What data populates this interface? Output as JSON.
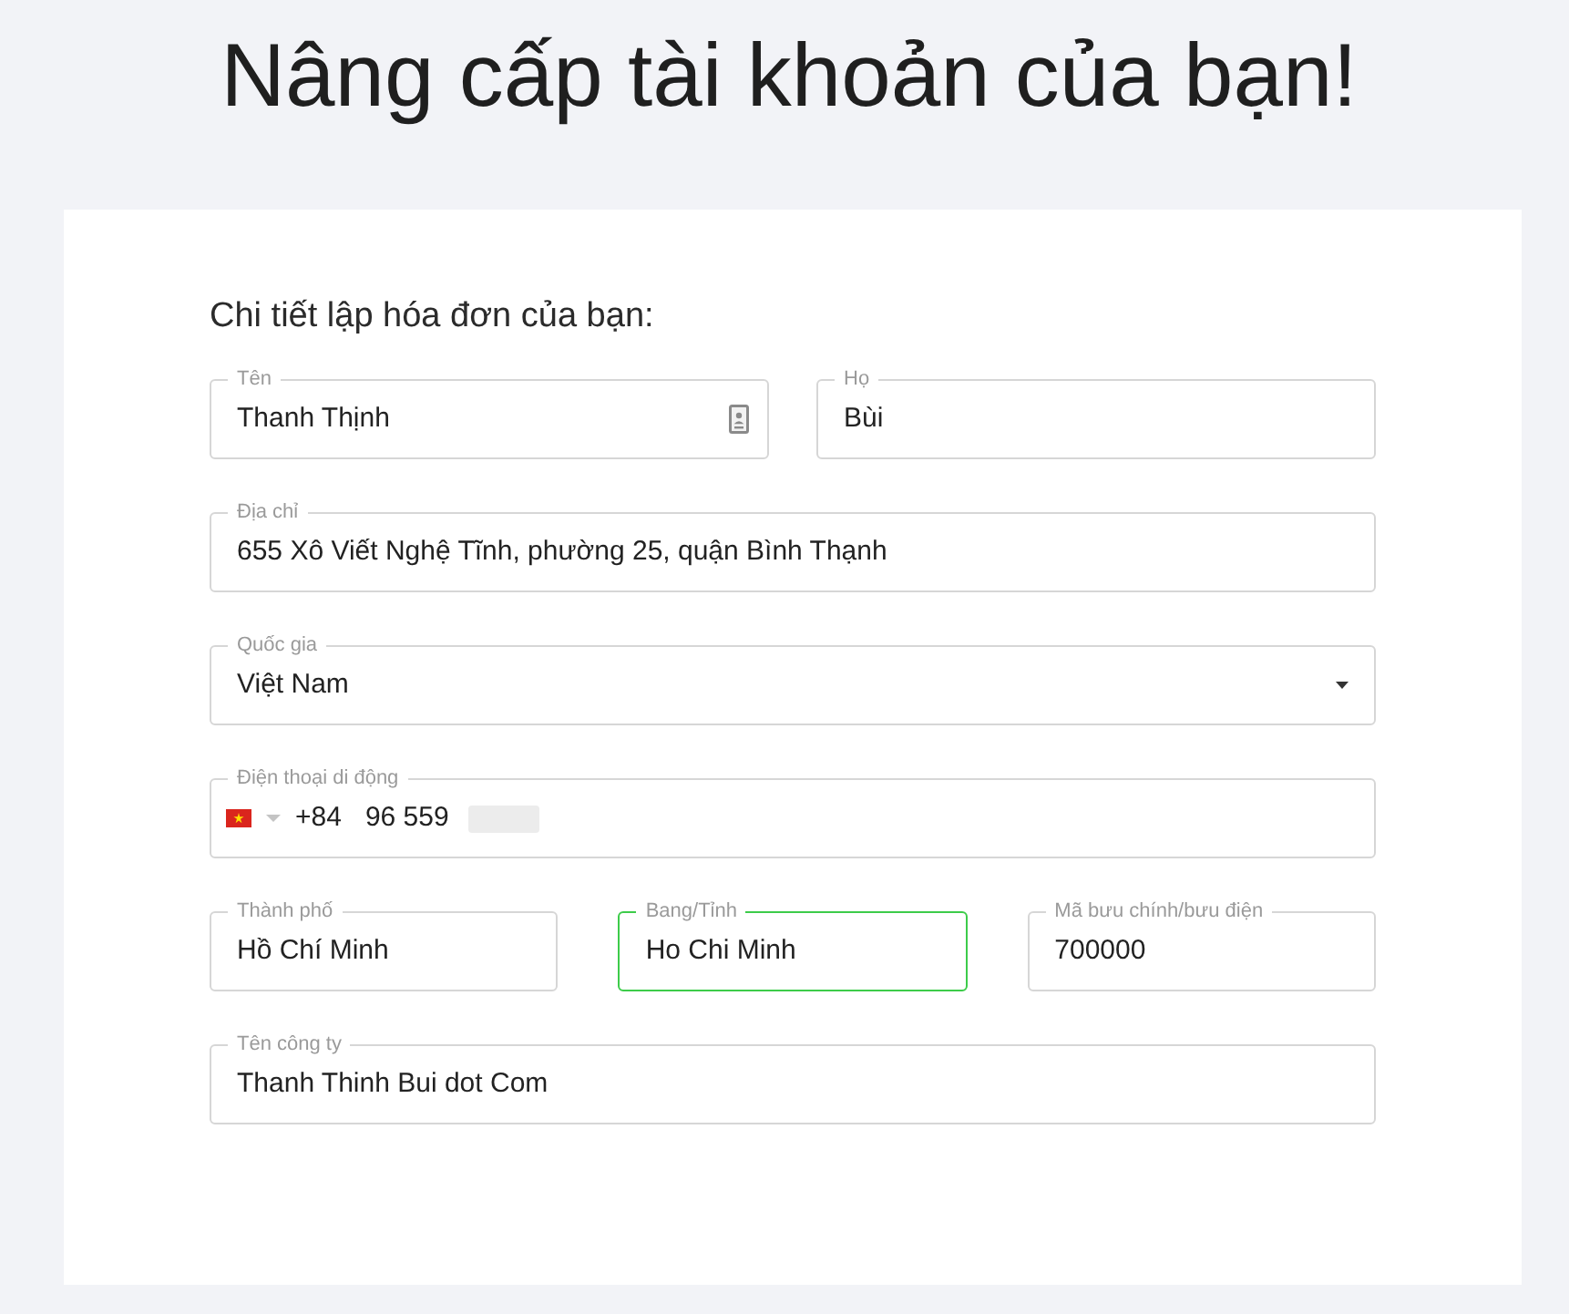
{
  "page_title": "Nâng cấp tài khoản của bạn!",
  "billing_form": {
    "heading": "Chi tiết lập hóa đơn của bạn:",
    "rows": [
      {
        "fields": [
          {
            "kind": "text",
            "label": "Tên",
            "value": "Thanh Thịnh",
            "focused": false,
            "autofill_icon": true
          },
          {
            "kind": "text",
            "label": "Họ",
            "value": "Bùi",
            "focused": false,
            "autofill_icon": false
          }
        ]
      },
      {
        "fields": [
          {
            "kind": "text",
            "label": "Địa chỉ",
            "value": "655 Xô Viết Nghệ Tĩnh, phường 25, quận Bình Thạnh",
            "focused": false,
            "autofill_icon": false
          }
        ]
      },
      {
        "fields": [
          {
            "kind": "select",
            "label": "Quốc gia",
            "value": "Việt Nam",
            "focused": false,
            "autofill_icon": false
          }
        ]
      },
      {
        "fields": [
          {
            "kind": "phone",
            "label": "Điện thoại di động",
            "dial_code": "+84",
            "value": "96 559",
            "redacted": true,
            "focused": false,
            "autofill_icon": false
          }
        ]
      },
      {
        "fields": [
          {
            "kind": "text",
            "label": "Thành phố",
            "value": "Hồ Chí Minh",
            "focused": false,
            "autofill_icon": false
          },
          {
            "kind": "text",
            "label": "Bang/Tỉnh",
            "value": "Ho Chi Minh",
            "focused": true,
            "autofill_icon": false
          },
          {
            "kind": "text",
            "label": "Mã bưu chính/bưu điện",
            "value": "700000",
            "focused": false,
            "autofill_icon": false
          }
        ]
      },
      {
        "fields": [
          {
            "kind": "text",
            "label": "Tên công ty",
            "value": "Thanh Thinh Bui dot Com",
            "focused": false,
            "autofill_icon": false
          }
        ]
      }
    ]
  }
}
